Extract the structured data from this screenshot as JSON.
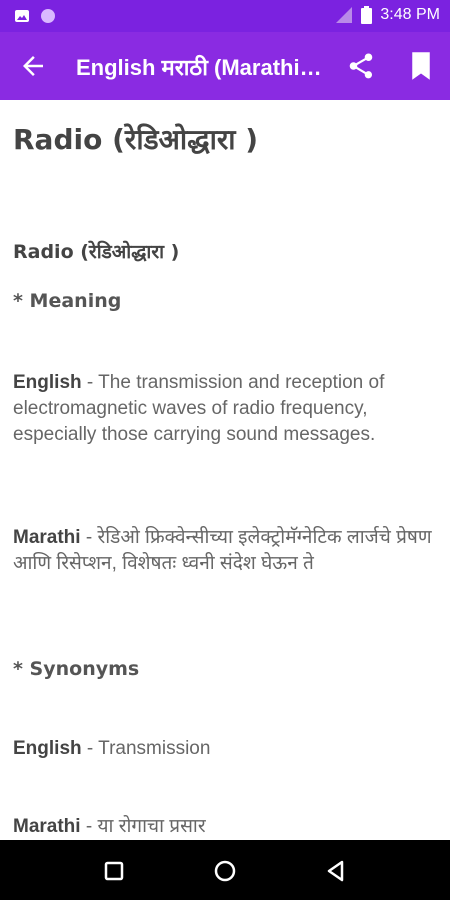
{
  "status_bar": {
    "time": "3:48 PM"
  },
  "app_bar": {
    "title": "English मराठी (Marathi) Dictionary",
    "back_icon": "arrow-back",
    "share_icon": "share",
    "bookmark_icon": "bookmark"
  },
  "entry": {
    "headword": "Radio (रेडिओद्धारा )",
    "sub_headword": "Radio (रेडिओद्धारा )",
    "meaning_label": "*  Meaning",
    "meaning_english_lang": "English",
    "meaning_english_text": "The transmission and reception of electromagnetic waves of radio frequency, especially those carrying sound messages.",
    "meaning_marathi_lang": "Marathi",
    "meaning_marathi_text": "रेडिओ फ्रिक्वेन्सीच्या इलेक्ट्रोमॅग्नेटिक लार्जचे प्रेषण आणि रिसेप्शन, विशेषतः ध्वनी संदेश घेऊन ते",
    "synonyms_label": "*  Synonyms",
    "syn_english_lang": "English",
    "syn_english_text": "Transmission",
    "syn_marathi_lang": "Marathi",
    "syn_marathi_text": "या रोगाचा प्रसार",
    "separator": " - "
  },
  "colors": {
    "app_bar": "#8a2be2",
    "status_bar": "#7b22e0",
    "nav_bar": "#000000"
  }
}
